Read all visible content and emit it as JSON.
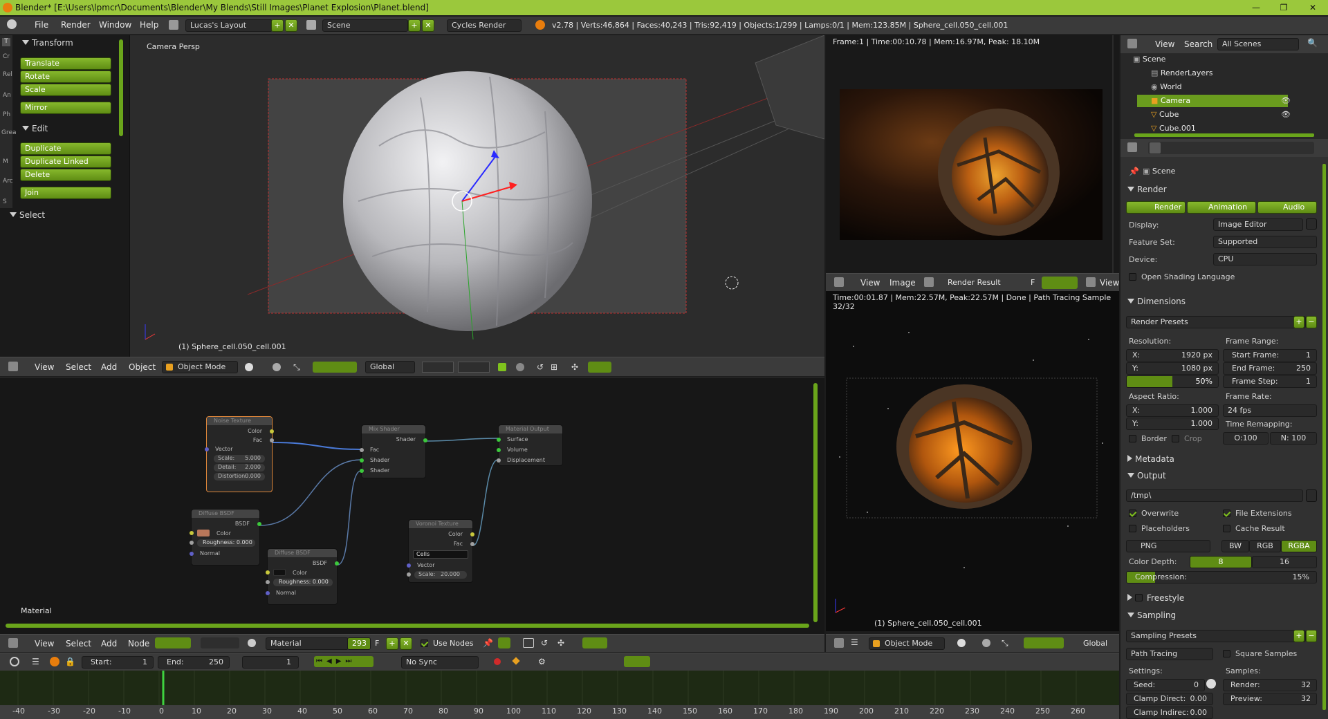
{
  "window": {
    "title": "Blender* [E:\\Users\\lpmcr\\Documents\\Blender\\My Blends\\Still Images\\Planet Explosion\\Planet.blend]"
  },
  "topmenu": [
    "File",
    "Render",
    "Window",
    "Help"
  ],
  "layout": "Lucas's Layout",
  "scene": "Scene",
  "engine": "Cycles Render",
  "stats": "v2.78 | Verts:46,864 | Faces:40,243 | Tris:92,419 | Objects:1/299 | Lamps:0/1 | Mem:123.85M | Sphere_cell.050_cell.001",
  "toolshelf": {
    "tabs": [
      "T",
      "Cr",
      "Rel",
      "An",
      "Ph",
      "Grea",
      "M",
      "Arc",
      "S"
    ],
    "transform": "Transform",
    "transform_btns": [
      "Translate",
      "Rotate",
      "Scale",
      "Mirror"
    ],
    "edit": "Edit",
    "edit_btns": [
      "Duplicate",
      "Duplicate Linked",
      "Delete",
      "Join"
    ],
    "select": "Select"
  },
  "viewport": {
    "label": "Camera Persp",
    "object": "(1) Sphere_cell.050_cell.001",
    "menu": [
      "View",
      "Select",
      "Add",
      "Object"
    ],
    "mode": "Object Mode",
    "orientation": "Global"
  },
  "render_top": {
    "info": "Frame:1 | Time:00:10.78 | Mem:16.97M, Peak: 18.10M"
  },
  "image_editor": {
    "menu": [
      "View",
      "Image"
    ],
    "name": "Render Result",
    "f": "F",
    "view": "View",
    "info": "Time:00:01.87 | Mem:22.57M, Peak:22.57M | Done | Path Tracing Sample 32/32",
    "object": "(1) Sphere_cell.050_cell.001",
    "mode": "Object Mode",
    "orientation": "Global"
  },
  "node_editor": {
    "label": "Material",
    "menu": [
      "View",
      "Select",
      "Add",
      "Node"
    ],
    "material": "Material",
    "users": "293",
    "f": "F",
    "use_nodes": "Use Nodes",
    "nodes": {
      "noise": {
        "title": "Noise Texture",
        "out1": "Color",
        "out2": "Fac",
        "in": "Vector",
        "scale": "Scale:",
        "scale_v": "5.000",
        "detail": "Detail:",
        "detail_v": "2.000",
        "distortion": "Distortion:",
        "distortion_v": "0.000"
      },
      "mix": {
        "title": "Mix Shader",
        "out": "Shader",
        "in1": "Fac",
        "in2": "Shader",
        "in3": "Shader"
      },
      "output": {
        "title": "Material Output",
        "in1": "Surface",
        "in2": "Volume",
        "in3": "Displacement"
      },
      "diff1": {
        "title": "Diffuse BSDF",
        "out": "BSDF",
        "color": "Color",
        "rough": "Roughness: 0.000",
        "normal": "Normal",
        "swatch": "#b9775a"
      },
      "diff2": {
        "title": "Diffuse BSDF",
        "out": "BSDF",
        "color": "Color",
        "rough": "Roughness: 0.000",
        "normal": "Normal",
        "swatch": "#111111"
      },
      "voronoi": {
        "title": "Voronoi Texture",
        "out1": "Color",
        "out2": "Fac",
        "mode": "Cells",
        "in": "Vector",
        "scale": "Scale:",
        "scale_v": "20.000"
      }
    }
  },
  "timeline": {
    "start_label": "Start:",
    "start": "1",
    "end_label": "End:",
    "end": "250",
    "frame": "1",
    "sync": "No Sync",
    "ticks": [
      "-40",
      "-30",
      "-20",
      "-10",
      "0",
      "10",
      "20",
      "30",
      "40",
      "50",
      "60",
      "70",
      "80",
      "90",
      "100",
      "110",
      "120",
      "130",
      "140",
      "150",
      "160",
      "170",
      "180",
      "190",
      "200",
      "210",
      "220",
      "230",
      "240",
      "250",
      "260"
    ]
  },
  "outliner": {
    "menu": [
      "View",
      "Search"
    ],
    "filter": "All Scenes",
    "items": [
      "Scene",
      "RenderLayers",
      "World",
      "Camera",
      "Cube",
      "Cube.001"
    ]
  },
  "properties": {
    "breadcrumb": "Scene",
    "render": "Render",
    "render_btns": [
      "Render",
      "Animation",
      "Audio"
    ],
    "display_label": "Display:",
    "display": "Image Editor",
    "featureset_label": "Feature Set:",
    "featureset": "Supported",
    "device_label": "Device:",
    "device": "CPU",
    "osl": "Open Shading Language",
    "dimensions": "Dimensions",
    "render_presets": "Render Presets",
    "resolution": "Resolution:",
    "res_x": "1920 px",
    "res_y": "1080 px",
    "res_pct": "50%",
    "res_pct_value": 0.5,
    "x": "X:",
    "y": "Y:",
    "frame_range": "Frame Range:",
    "start_frame": "Start Frame:",
    "start_frame_v": "1",
    "end_frame": "End Frame:",
    "end_frame_v": "250",
    "frame_step": "Frame Step:",
    "frame_step_v": "1",
    "aspect": "Aspect Ratio:",
    "aspect_x": "1.000",
    "aspect_y": "1.000",
    "frame_rate": "Frame Rate:",
    "fps": "24 fps",
    "time_remap": "Time Remapping:",
    "remap_old": "O:100",
    "remap_new": "N: 100",
    "border": "Border",
    "crop": "Crop",
    "metadata": "Metadata",
    "output": "Output",
    "path": "/tmp\\",
    "overwrite": "Overwrite",
    "file_ext": "File Extensions",
    "placeholders": "Placeholders",
    "cache": "Cache Result",
    "format": "PNG",
    "bw": "BW",
    "rgb": "RGB",
    "rgba": "RGBA",
    "color_depth": "Color Depth:",
    "depth8": "8",
    "depth16": "16",
    "compression": "Compression:",
    "compression_v": "15%",
    "compression_value": 0.15,
    "freestyle": "Freestyle",
    "sampling": "Sampling",
    "sampling_presets": "Sampling Presets",
    "integrator": "Path Tracing",
    "square": "Square Samples",
    "settings": "Settings:",
    "samples": "Samples:",
    "seed": "Seed:",
    "seed_v": "0",
    "clamp_direct": "Clamp Direct:",
    "clamp_direct_v": "0.00",
    "clamp_indirect": "Clamp Indirec:",
    "clamp_indirect_v": "0.00",
    "render_s": "Render:",
    "render_s_v": "32",
    "preview_s": "Preview:",
    "preview_s_v": "32"
  }
}
